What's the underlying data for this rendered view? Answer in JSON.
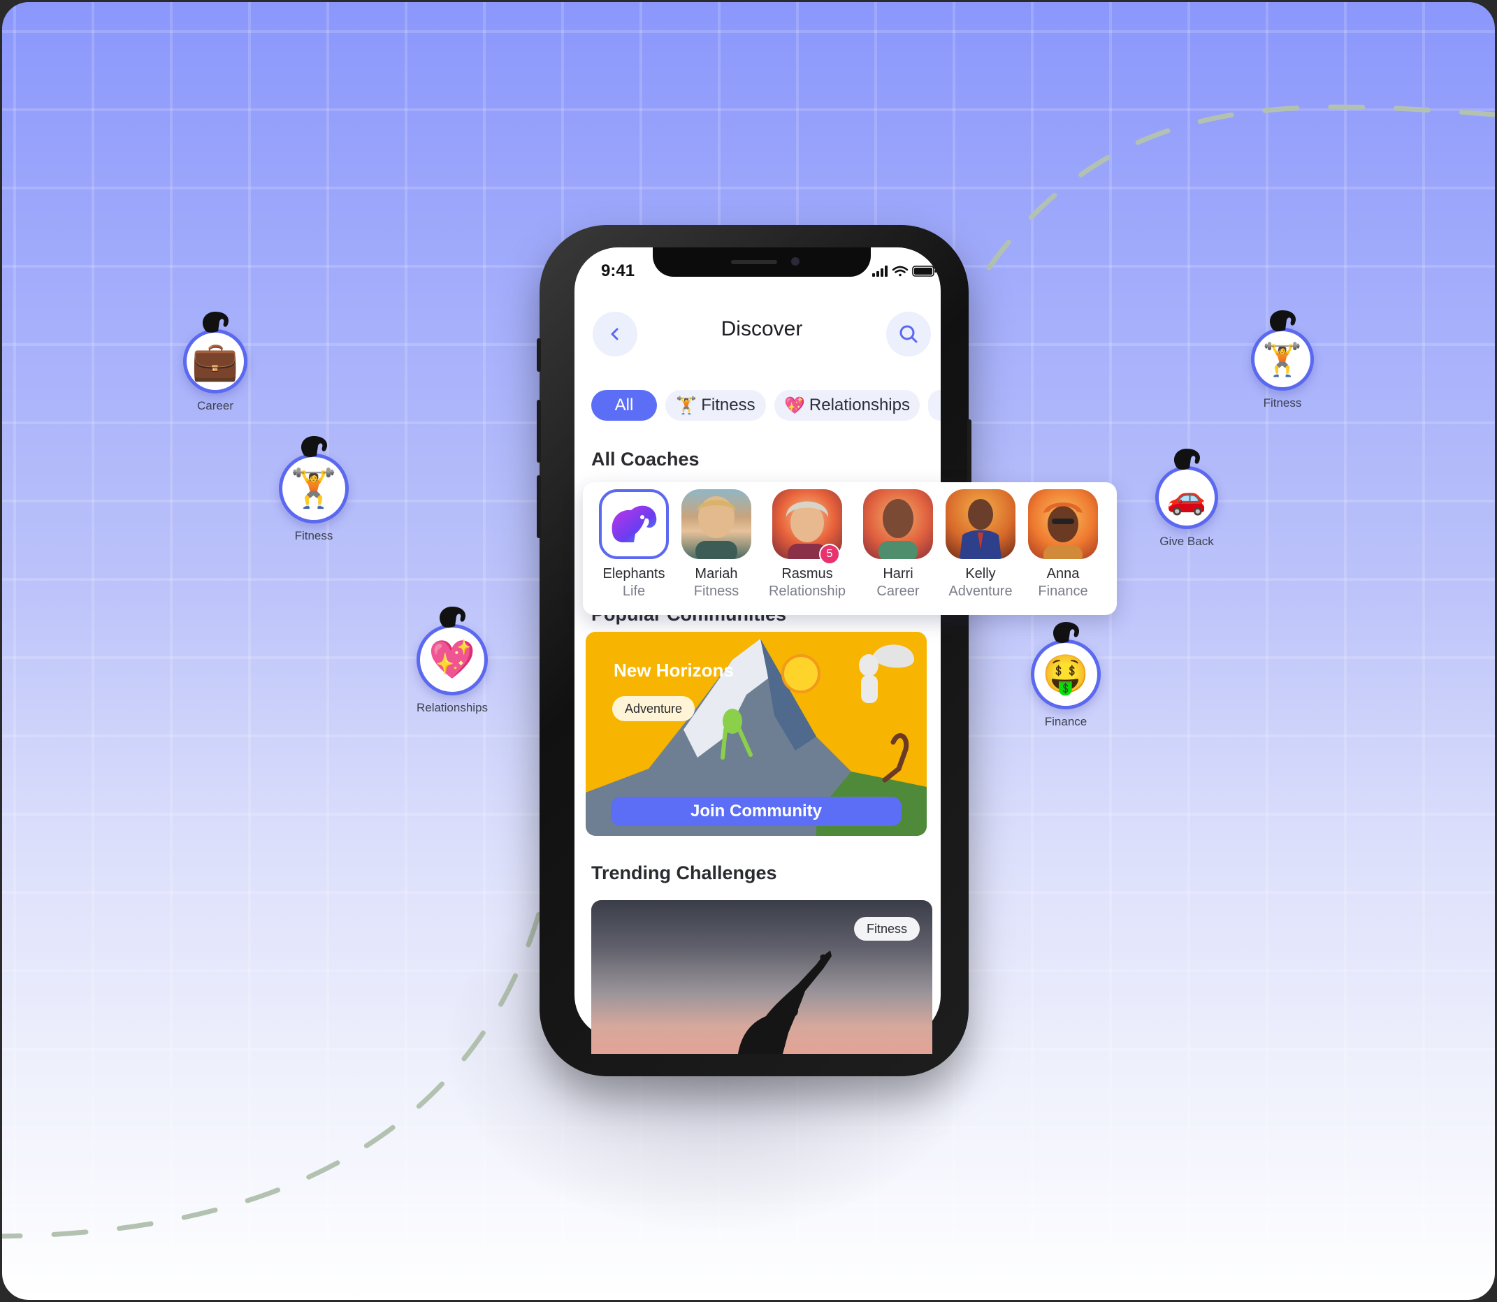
{
  "status_bar": {
    "time": "9:41"
  },
  "header": {
    "title": "Discover",
    "back_icon": "chevron-left-icon",
    "search_icon": "search-icon"
  },
  "filters": [
    {
      "label": "All",
      "icon": "",
      "active": true
    },
    {
      "label": "Fitness",
      "icon": "🏋️",
      "active": false
    },
    {
      "label": "Relationships",
      "icon": "💖",
      "active": false
    }
  ],
  "sections": {
    "coaches": "All Coaches",
    "communities": "Popular Communities",
    "challenges": "Trending Challenges"
  },
  "coaches": [
    {
      "name": "Elephants",
      "role": "Life"
    },
    {
      "name": "Mariah",
      "role": "Fitness"
    },
    {
      "name": "Rasmus",
      "role": "Relationship",
      "badge": "5"
    },
    {
      "name": "Harri",
      "role": "Career"
    },
    {
      "name": "Kelly",
      "role": "Adventure"
    },
    {
      "name": "Anna",
      "role": "Finance"
    }
  ],
  "community": {
    "title": "New Horizons",
    "tag": "Adventure",
    "button": "Join Community"
  },
  "challenge": {
    "tag": "Fitness"
  },
  "floating_categories": [
    {
      "label": "Career",
      "icon": "💼"
    },
    {
      "label": "Fitness",
      "icon": "🏋️"
    },
    {
      "label": "Relationships",
      "icon": "💖"
    },
    {
      "label": "Fitness",
      "icon": "🏋️"
    },
    {
      "label": "Give Back",
      "icon": "🚗"
    },
    {
      "label": "Finance",
      "icon": "🤑"
    }
  ],
  "colors": {
    "accent": "#5b6ef5",
    "ring": "#5b68f0",
    "badge": "#e8336e",
    "community_bg": "#f7b400"
  }
}
